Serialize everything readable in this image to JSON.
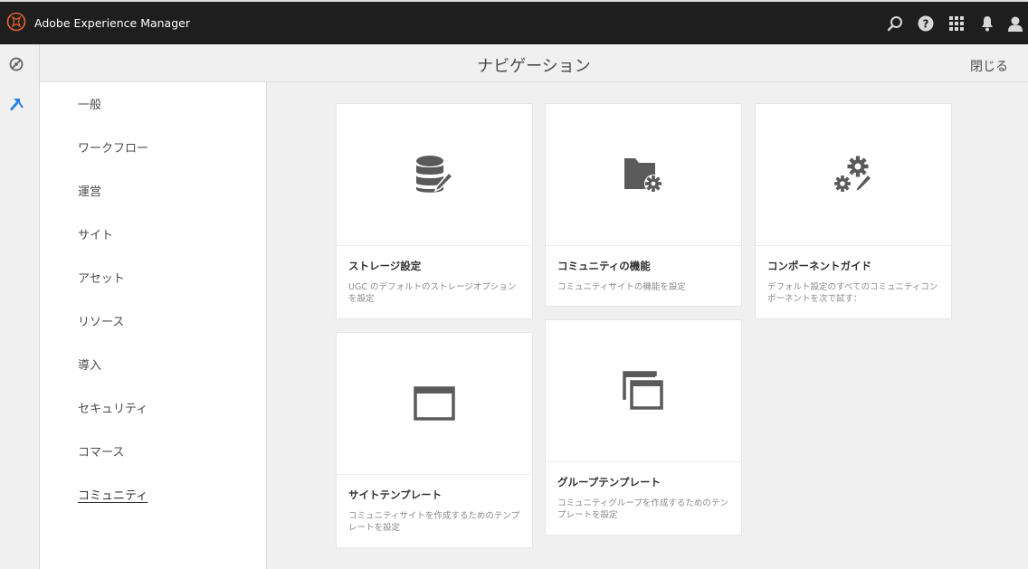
{
  "topbar": {
    "app_title": "Adobe Experience Manager",
    "icons": [
      "search-icon",
      "help-icon",
      "solutions-grid-icon",
      "notification-bell-icon",
      "user-icon"
    ]
  },
  "rail": {
    "icons": [
      "navigation-compass-icon",
      "tools-hammer-icon"
    ],
    "accent": "#2680eb"
  },
  "header": {
    "title": "ナビゲーション",
    "close_label": "閉じる"
  },
  "categories": [
    {
      "label": "一般",
      "active": false
    },
    {
      "label": "ワークフロー",
      "active": false
    },
    {
      "label": "運営",
      "active": false
    },
    {
      "label": "サイト",
      "active": false
    },
    {
      "label": "アセット",
      "active": false
    },
    {
      "label": "リソース",
      "active": false
    },
    {
      "label": "導入",
      "active": false
    },
    {
      "label": "セキュリティ",
      "active": false
    },
    {
      "label": "コマース",
      "active": false
    },
    {
      "label": "コミュニティ",
      "active": true
    }
  ],
  "cards": [
    {
      "icon": "database-edit-icon",
      "title": "ストレージ設定",
      "description": "UGC のデフォルトのストレージオプションを設定"
    },
    {
      "icon": "folder-gear-icon",
      "title": "コミュニティの機能",
      "description": "コミュニティサイトの機能を設定"
    },
    {
      "icon": "gears-edit-icon",
      "title": "コンポーネントガイド",
      "description": "デフォルト設定のすべてのコミュニティコンポーネントを次で試す："
    },
    {
      "icon": "window-icon",
      "title": "サイトテンプレート",
      "description": "コミュニティサイトを作成するためのテンプレートを設定"
    },
    {
      "icon": "stacked-windows-icon",
      "title": "グループテンプレート",
      "description": "コミュニティグループを作成するためのテンプレートを設定"
    }
  ],
  "colors": {
    "topbar_bg": "#1e1e1e",
    "logo_ring": "#e8632b",
    "icon_gray": "#5a5a5a"
  }
}
